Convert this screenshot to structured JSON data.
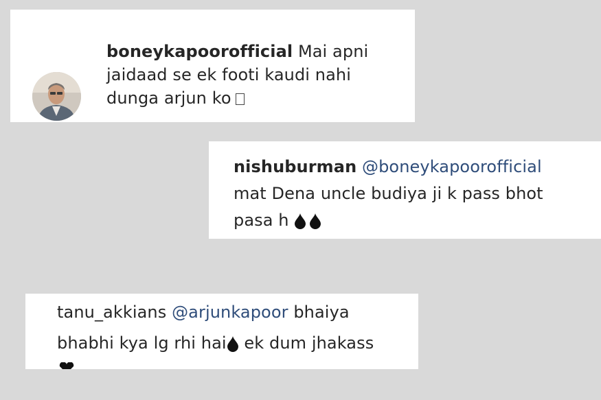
{
  "comments": [
    {
      "username": "boneykapoorofficial",
      "mention": "",
      "lines": [
        "Mai apni",
        "jaidaad se ek footi kaudi nahi",
        "dunga arjun ko"
      ],
      "trailing_icon": "missing-glyph-box-icon"
    },
    {
      "username": "nishuburman",
      "mention": "@boneykapoorofficial",
      "lines": [
        "mat Dena uncle budiya ji k pass bhot",
        "pasa h"
      ],
      "trailing_icon": "black-drop-icon"
    },
    {
      "username": "tanu_akkians",
      "mention": "@arjunkapoor",
      "lines": [
        "bhaiya",
        "bhabhi kya lg rhi hai",
        "ek dum jhakass"
      ],
      "trailing_icon": "black-drop-icon"
    }
  ],
  "colors": {
    "background": "#d9d9d9",
    "card": "#ffffff",
    "text": "#262626",
    "mention": "#2f4d7a"
  }
}
